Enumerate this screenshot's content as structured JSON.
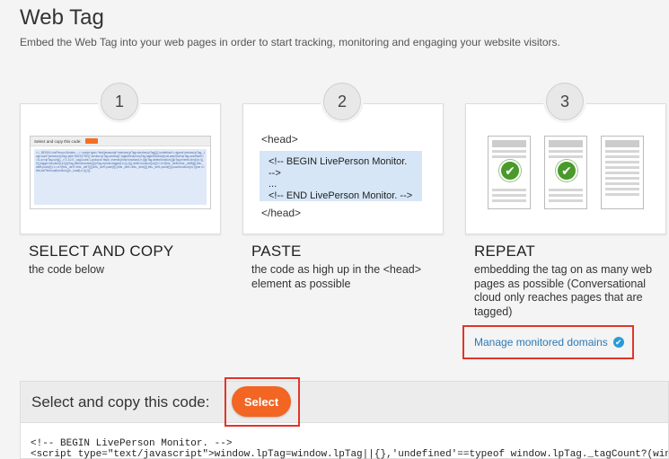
{
  "page": {
    "title": "Web Tag",
    "description": "Embed the Web Tag into your web pages in order to start tracking, monitoring and engaging your website visitors."
  },
  "steps": [
    {
      "number": "1",
      "heading": "SELECT AND COPY",
      "body": "the code below",
      "thumb_header": "Select and copy this code:",
      "thumb_code": "<!-- BEGIN LivePerson Monitor. --> <script type=\"text/javascript\">window.lpTag=window.lpTag||{},'undefined'==typeof window.lpTag._tagCount?(window.lpTag={site:'55219706'||'',section:lpTag.section||'',tagletSection:lpTag.tagletSection||null,autoStart:lpTag.autoStart!==!1,ovr:lpTag.ovr||{},_v:'1.10.0',_tagCount:1,protocol:'https:',events:{bind:function(t,e,i){lpTag.defer(function(){lpTag.events.bind(t,e,i)},0)},trigger:function(t,e,i){lpTag.defer(function(){lpTag.events.trigger(t,e,i)},1)}},defer:function(t,e){0==e?(this._defB=this._defB||[],this._defB.push(t)):1==e?(this._defT=this._defT||[],this._defT.push(t)):(this._defL=this._defL||[],this._defL.push(t))},load:function(t,e,i){var n=this;setTimeout(function(){n._load(t,e,i)},0)}"
    },
    {
      "number": "2",
      "heading": "PASTE",
      "body": "the code as high up in the <head> element as possible",
      "head_open": "<head>",
      "code_line_1": "<!-- BEGIN LivePerson Monitor. -->",
      "code_line_2": "...",
      "code_line_3": "<!-- END LivePerson Monitor. -->",
      "head_close": "</head>"
    },
    {
      "number": "3",
      "heading": "REPEAT",
      "body": "embedding the tag on as many web pages as possible (Conversational cloud only reaches pages that are tagged)",
      "check_icon": "✔"
    }
  ],
  "manage": {
    "link_label": "Manage monitored domains",
    "icon": "verified-check-icon",
    "icon_glyph": "✔"
  },
  "code_panel": {
    "title": "Select and copy this code:",
    "select_label": "Select",
    "code": "<!-- BEGIN LivePerson Monitor. -->\n<script type=\"text/javascript\">window.lpTag=window.lpTag||{},'undefined'==typeof window.lpTag._tagCount?(window.lpTag="
  },
  "colors": {
    "accent_orange": "#f26522",
    "highlight_red": "#e1352a",
    "link_blue": "#2a7ab8",
    "check_green": "#4a9a2b",
    "code_blue_bg": "#d6e6f7"
  }
}
